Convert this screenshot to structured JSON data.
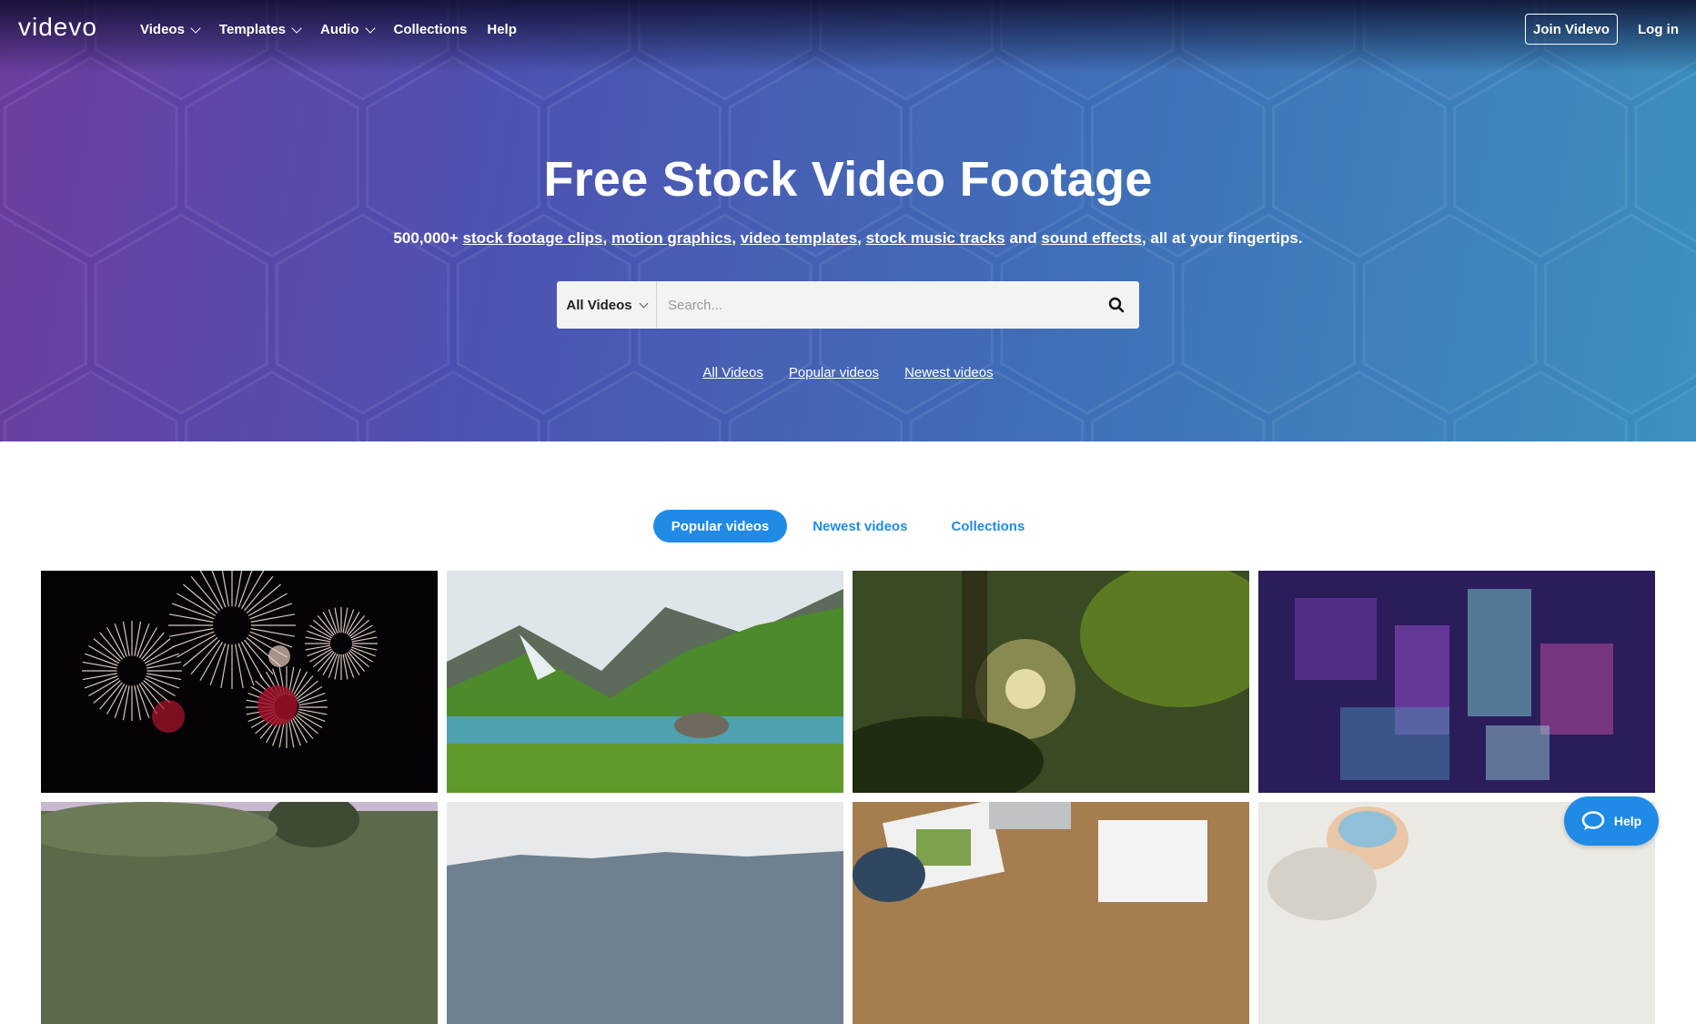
{
  "nav": {
    "logo": "videvo",
    "items": [
      {
        "label": "Videos",
        "has_dropdown": true
      },
      {
        "label": "Templates",
        "has_dropdown": true
      },
      {
        "label": "Audio",
        "has_dropdown": true
      },
      {
        "label": "Collections",
        "has_dropdown": false
      },
      {
        "label": "Help",
        "has_dropdown": false
      }
    ],
    "join_label": "Join Videvo",
    "login_label": "Log in"
  },
  "hero": {
    "title": "Free Stock Video Footage",
    "sub_prefix": "500,000+",
    "sub_links": [
      "stock footage clips",
      "motion graphics",
      "video templates",
      "stock music tracks",
      "sound effects"
    ],
    "sub_and": "and",
    "sub_suffix": ", all at your fingertips.",
    "search_category": "All Videos",
    "search_placeholder": "Search...",
    "quick_links": [
      "All Videos",
      "Popular videos",
      "Newest videos"
    ]
  },
  "tabs": [
    {
      "label": "Popular videos",
      "active": true
    },
    {
      "label": "Newest videos",
      "active": false
    },
    {
      "label": "Collections",
      "active": false
    }
  ],
  "thumbnails": [
    {
      "name": "fireworks"
    },
    {
      "name": "mountain-river"
    },
    {
      "name": "sunlit-leaves"
    },
    {
      "name": "digital-city"
    },
    {
      "name": "tree-landscape"
    },
    {
      "name": "misty-hills"
    },
    {
      "name": "desk-documents"
    },
    {
      "name": "masked-person"
    }
  ],
  "help": {
    "label": "Help"
  },
  "colors": {
    "accent": "#1f8be6",
    "hero_start": "#6a3a9e",
    "hero_end": "#3a8fbf"
  }
}
